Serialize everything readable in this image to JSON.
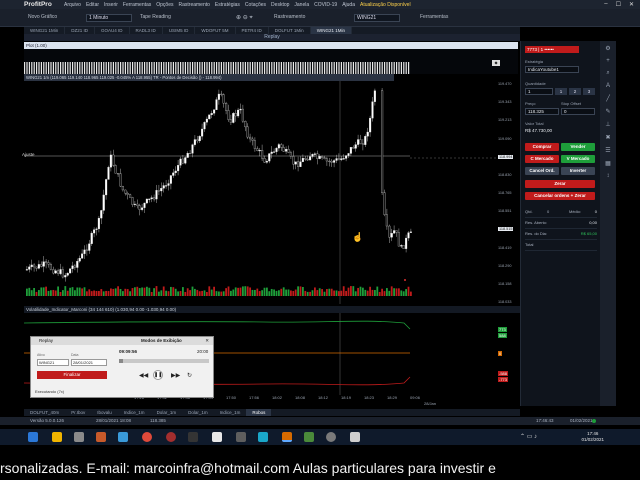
{
  "app": {
    "name": "ProfitPro",
    "menu": [
      "Arquivo",
      "Editar",
      "Inserir",
      "Ferramentas",
      "Opções",
      "Rastreamento",
      "Estratégias",
      "Cotações",
      "Desktop",
      "Janela",
      "COVID-19",
      "Ajuda",
      "Atualização Disponível"
    ]
  },
  "toolbar": {
    "chart_type": "Novo Gráfico",
    "interval": "1 Minuto",
    "tape_reading": "Tape Reading",
    "ticker": "WING21",
    "rastreamento": "Rastreamento",
    "ferramentas": "Ferramentas"
  },
  "tabs": [
    "WING21 1Min",
    "DZ21 ID",
    "GOAU4 ID",
    "RADL3 ID",
    "USIM5 ID",
    "WDOFUT 5M",
    "PETR4 ID",
    "DOLFUT 1Min",
    "WING21 1Min"
  ],
  "replay_bar": "Replay",
  "plot_header": "Plot (1.00)",
  "chart_header": "WING21 1m (119.065  119.140  118.965  119.025  -0.045%  A 118.955)  TR - Pontos de Decisão ()  -  118.994)",
  "ajuste_label": "Ajuste",
  "yaxis": {
    "ticks": [
      "119.470",
      "119.343",
      "119.213",
      "119.090",
      "118.994",
      "118.830",
      "118.765",
      "118.551",
      "118.515",
      "118.419",
      "118.290",
      "118.158",
      "118.033"
    ],
    "highlight_1": "118.994",
    "highlight_2": "118.515"
  },
  "indicator_header": "Volatilidade_Indicator_Marconi (34 144 610) (1.030,94  0.00  -1.030,94  0.00)",
  "indicator_axis": [
    "773",
    "588",
    "0",
    "-588",
    "-773"
  ],
  "time_axis": [
    "17:26",
    "17:32",
    "17:38",
    "17:44",
    "17:50",
    "17:56",
    "18:02",
    "18:08",
    "18:12",
    "18:19",
    "18:23",
    "18:29",
    "09:06"
  ],
  "time_axis_date": "28/Jan",
  "right_panel": {
    "account": "7773 | 1 ••••••",
    "strategy_label": "Estratégia",
    "strategy_value": "IndicaYoutube1",
    "qty_label": "Quantidade",
    "qty_value": "1",
    "qty_buttons": [
      "1",
      "2",
      "3"
    ],
    "price_label": "Preço",
    "stop_label": "Stop Offset",
    "price_value": "118.325",
    "stop_value": "0",
    "total_label": "Valor Total",
    "total_value": "R$ 47.730,00",
    "btn_buy": "Comprar",
    "btn_sell": "Vender",
    "btn_market_buy": "C Mercado",
    "btn_market_sell": "V Mercado",
    "btn_cancel": "Cancel Ord.",
    "btn_reverse": "Inverter",
    "btn_zero": "Zerar",
    "btn_cancel_zero": "Cancelar ordens + Zerar",
    "rows": [
      {
        "l": "Qtd.",
        "v": "0",
        "l2": "Médio:",
        "v2": "0"
      },
      {
        "l": "Res. Aberto:",
        "v": "",
        "l2": "",
        "v2": "0,00"
      },
      {
        "l": "Res. do Dia:",
        "v": "",
        "l2": "",
        "v2": "R$ 65,00"
      },
      {
        "l": "Total",
        "v": "",
        "l2": "",
        "v2": ""
      }
    ]
  },
  "replay_dialog": {
    "title": "Replay",
    "mode": "Modos de Exibição",
    "time": "09:09:56",
    "end_time": "20:00",
    "asset_label": "Ativo",
    "date_label": "Data",
    "asset": "WING21",
    "date": "28/01/2021",
    "btn_finalize": "Finalizar",
    "status": "Executando (7x)"
  },
  "bottom_tabs": [
    "DOLFUT_40m",
    "Pr.Ibov",
    "Ibovalu",
    "Indice_1m",
    "Dolar_1m",
    "Dolar_1m",
    "Indice_1m",
    "Robos"
  ],
  "statusbar": {
    "version": "Versão 5.0.0.126",
    "date": "28/01/2021  18:08",
    "count": "118.385",
    "time": "17:46:43",
    "date2": "01/02/2021"
  },
  "clock": {
    "time": "17:46",
    "date": "01/02/2021"
  },
  "marquee": "rsonalizadas. E-mail: marcoinfra@hotmail.com      Aulas particulares para investir e",
  "colors": {
    "buy": "#1e9e3a",
    "sell": "#c01b1b",
    "bull": "#ffffff",
    "bear": "#111111"
  }
}
